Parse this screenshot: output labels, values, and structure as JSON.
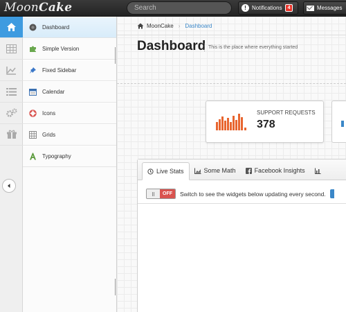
{
  "app": {
    "logo_light": "Moon",
    "logo_bold": "Cake"
  },
  "search": {
    "placeholder": "Search"
  },
  "topbar": {
    "notifications_label": "Notifications",
    "notifications_count": "4",
    "messages_label": "Messages"
  },
  "sidebar": {
    "items": [
      {
        "label": "Dashboard",
        "icon": "dashboard-icon"
      },
      {
        "label": "Simple Version",
        "icon": "puzzle-icon"
      },
      {
        "label": "Fixed Sidebar",
        "icon": "pin-icon"
      },
      {
        "label": "Calendar",
        "icon": "calendar-icon"
      },
      {
        "label": "Icons",
        "icon": "lifebuoy-icon"
      },
      {
        "label": "Grids",
        "icon": "grid-icon"
      },
      {
        "label": "Typography",
        "icon": "typography-icon"
      }
    ]
  },
  "breadcrumb": {
    "home": "MoonCake",
    "current": "Dashboard"
  },
  "page": {
    "title": "Dashboard",
    "subtitle": "This is the place where everything started"
  },
  "stat": {
    "label": "SUPPORT REQUESTS",
    "value": "378"
  },
  "widget": {
    "tabs": [
      "Live Stats",
      "Some Math",
      "Facebook Insights"
    ],
    "toggle_state": "OFF",
    "toggle_text": "Switch to see the widgets below updating every second."
  },
  "colors": {
    "accent": "#3e9be0",
    "bars": "#e8652f",
    "off": "#d9534f",
    "badge": "#e8342a"
  }
}
